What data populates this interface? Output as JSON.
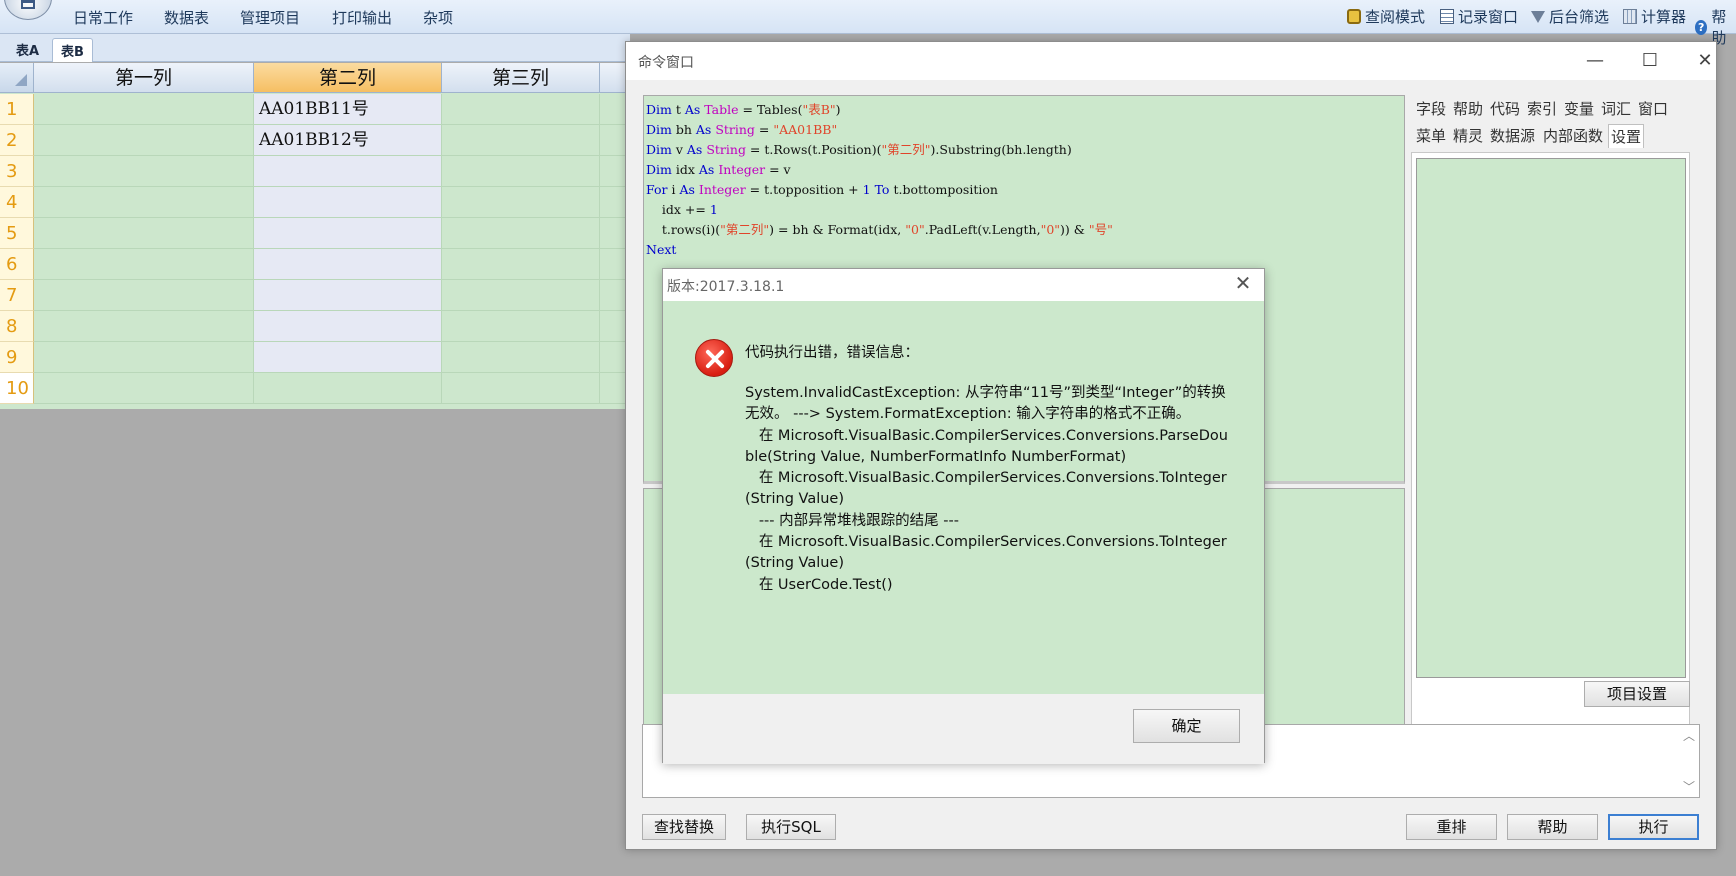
{
  "menubar": {
    "menus": [
      "日常工作",
      "数据表",
      "管理项目",
      "打印输出",
      "杂项"
    ],
    "tools": [
      {
        "icon": "lock-icon",
        "label": "查阅模式"
      },
      {
        "icon": "record-window-icon",
        "label": "记录窗口"
      },
      {
        "icon": "filter-icon",
        "label": "后台筛选"
      },
      {
        "icon": "calculator-icon",
        "label": "计算器"
      },
      {
        "icon": "help-icon",
        "label": "帮助"
      }
    ]
  },
  "table_tabs": [
    "表A",
    "表B"
  ],
  "active_table": "表B",
  "grid": {
    "columns": [
      "第一列",
      "第二列",
      "第三列"
    ],
    "selected_column": "第二列",
    "rows": [
      {
        "no": "1",
        "cells": [
          "",
          "AA01BB11号",
          ""
        ]
      },
      {
        "no": "2",
        "cells": [
          "",
          "AA01BB12号",
          ""
        ]
      },
      {
        "no": "3",
        "cells": [
          "",
          "",
          ""
        ]
      },
      {
        "no": "4",
        "cells": [
          "",
          "",
          ""
        ]
      },
      {
        "no": "5",
        "cells": [
          "",
          "",
          ""
        ]
      },
      {
        "no": "6",
        "cells": [
          "",
          "",
          ""
        ]
      },
      {
        "no": "7",
        "cells": [
          "",
          "",
          ""
        ]
      },
      {
        "no": "8",
        "cells": [
          "",
          "",
          ""
        ]
      },
      {
        "no": "9",
        "cells": [
          "",
          "",
          ""
        ]
      },
      {
        "no": "10",
        "cells": [
          "",
          "",
          ""
        ]
      }
    ]
  },
  "cmdwin": {
    "title": "命令窗口",
    "window_buttons": {
      "minimize": "—",
      "maximize": "☐",
      "close": "✕"
    },
    "code_lines": [
      "Dim t As Table = Tables(\"表B\")",
      "Dim bh As String = \"AA01BB\"",
      "Dim v As String = t.Rows(t.Position)(\"第二列\").Substring(bh.length)",
      "Dim idx As Integer = v",
      "For i As Integer = t.topposition + 1 To t.bottomposition",
      "    idx += 1",
      "    t.rows(i)(\"第二列\") = bh & Format(idx, \"0\".PadLeft(v.Length,\"0\")) & \"号\"",
      "Next"
    ],
    "side_tabs_row1": [
      "字段",
      "帮助",
      "代码",
      "索引",
      "变量",
      "词汇",
      "窗口"
    ],
    "side_tabs_row2": [
      "菜单",
      "精灵",
      "数据源",
      "内部函数",
      "设置"
    ],
    "active_side_tab": "设置",
    "project_settings_button": "项目设置",
    "scroll_up": "︿",
    "scroll_down": "﹀",
    "buttons": {
      "find_replace": "查找替换",
      "exec_sql": "执行SQL",
      "rearrange": "重排",
      "help": "帮助",
      "execute": "执行"
    }
  },
  "error_dialog": {
    "title": "版本:2017.3.18.1",
    "close": "✕",
    "heading": "代码执行出错，错误信息：",
    "detail": "System.InvalidCastException: 从字符串“11号”到类型“Integer”的转换无效。 ---> System.FormatException: 输入字符串的格式不正确。\n   在 Microsoft.VisualBasic.CompilerServices.Conversions.ParseDouble(String Value, NumberFormatInfo NumberFormat)\n   在 Microsoft.VisualBasic.CompilerServices.Conversions.ToInteger(String Value)\n   --- 内部异常堆栈跟踪的结尾 ---\n   在 Microsoft.VisualBasic.CompilerServices.Conversions.ToInteger(String Value)\n   在 UserCode.Test()",
    "ok_button": "确定"
  }
}
